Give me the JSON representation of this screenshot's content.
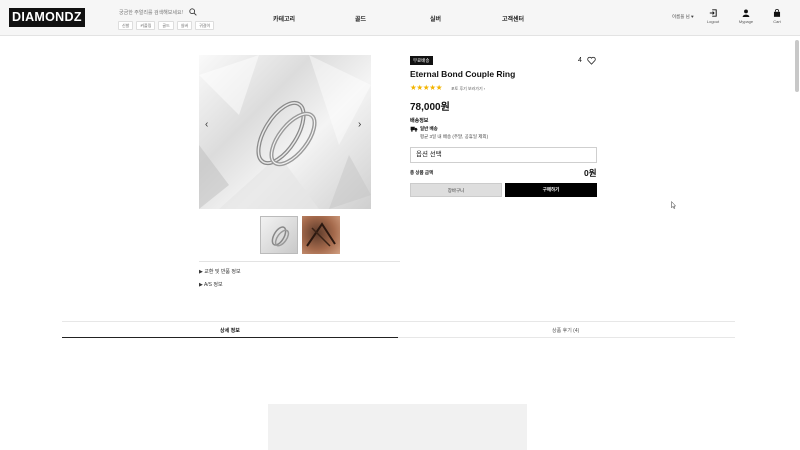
{
  "header": {
    "logo": "DIAMONDZ",
    "search_placeholder": "궁금한 주얼리를 검색해보세요!",
    "chips": [
      "신발",
      "커플링",
      "골드",
      "실버",
      "귀걸이"
    ],
    "nav": [
      "카테고리",
      "골드",
      "실버",
      "고객센터"
    ],
    "greeting": "이름을 님 ♥",
    "logout_label": "Logout",
    "mypage_label": "Mypage",
    "cart_label": "Cart"
  },
  "gallery": {
    "prev_icon": "‹",
    "next_icon": "›",
    "thumbnails": [
      "ring-photo",
      "wrapping-photo"
    ]
  },
  "accordion": [
    "▶ 교환 및 반품 정보",
    "▶ A/S 정보"
  ],
  "product": {
    "badge": "무료배송",
    "likes": "4",
    "title": "Eternal Bond Couple Ring",
    "stars": "★★★★★",
    "rating_value": 5,
    "review_link": "포토 후기 보러가기 ›",
    "price": "78,000원",
    "shipping_title": "배송정보",
    "shipping_type": "일반 배송",
    "shipping_desc": "평균 3일 내 배송 (주말, 공휴일 제외)",
    "option_placeholder": "옵션 선택",
    "total_label": "총 상품 금액",
    "total_value": "0원",
    "cart_button": "장바구니",
    "buy_button": "구매하기"
  },
  "tabs": [
    "상세 정보",
    "상품 후기 (4)"
  ],
  "colors": {
    "accent_black": "#000000",
    "star_yellow": "#f3b400",
    "header_bg": "#f6f6f6"
  }
}
